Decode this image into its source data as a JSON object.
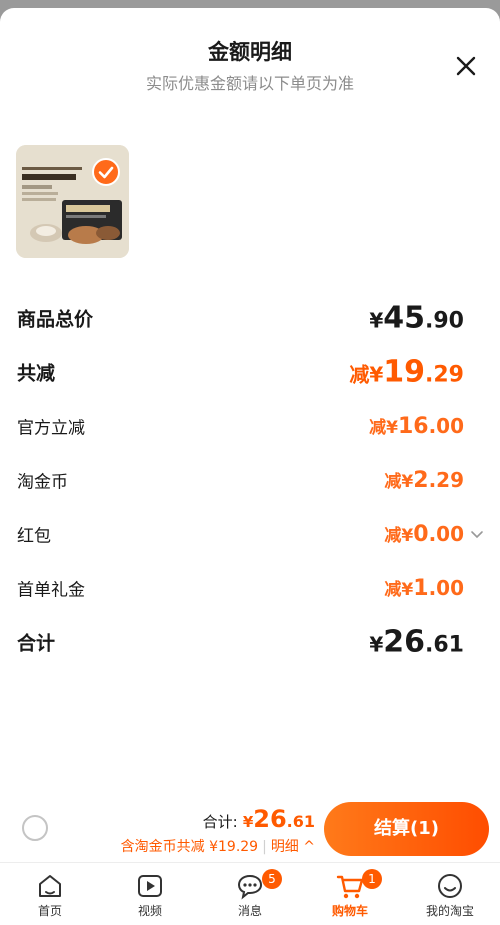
{
  "header": {
    "title": "金额明细",
    "subtitle": "实际优惠金额请以下单页为准"
  },
  "product": {
    "selected": true
  },
  "rows": {
    "total_price": {
      "label": "商品总价",
      "symbol": "¥",
      "int": "45",
      "dec": ".90"
    },
    "total_reduction": {
      "label": "共减",
      "prefix": "减¥",
      "int": "19",
      "dec": ".29"
    },
    "official_discount": {
      "label": "官方立减",
      "prefix": "减¥",
      "int": "16",
      "dec": ".00"
    },
    "tao_coin": {
      "label": "淘金币",
      "prefix": "减¥",
      "int": "2",
      "dec": ".29"
    },
    "red_packet": {
      "label": "红包",
      "prefix": "减¥",
      "int": "0",
      "dec": ".00"
    },
    "first_order_gift": {
      "label": "首单礼金",
      "prefix": "减¥",
      "int": "1",
      "dec": ".00"
    },
    "sum": {
      "label": "合计",
      "symbol": "¥",
      "int": "26",
      "dec": ".61"
    }
  },
  "checkout": {
    "total_label": "合计:",
    "total_symbol": "¥",
    "total_int": "26",
    "total_dec": ".61",
    "saving_text": "含淘金币共减 ¥19.29",
    "separator": "|",
    "detail_label": "明细",
    "detail_chevron": "^",
    "button_label": "结算(1)"
  },
  "tabbar": {
    "items": [
      {
        "label": "首页",
        "icon": "home-icon"
      },
      {
        "label": "视频",
        "icon": "video-icon"
      },
      {
        "label": "消息",
        "icon": "message-icon",
        "badge": "5"
      },
      {
        "label": "购物车",
        "icon": "cart-icon",
        "badge": "1",
        "active": true
      },
      {
        "label": "我的淘宝",
        "icon": "profile-icon"
      }
    ]
  },
  "colors": {
    "accent": "#ff5a00",
    "text": "#1a1a1a",
    "muted": "#8c8c8c"
  }
}
